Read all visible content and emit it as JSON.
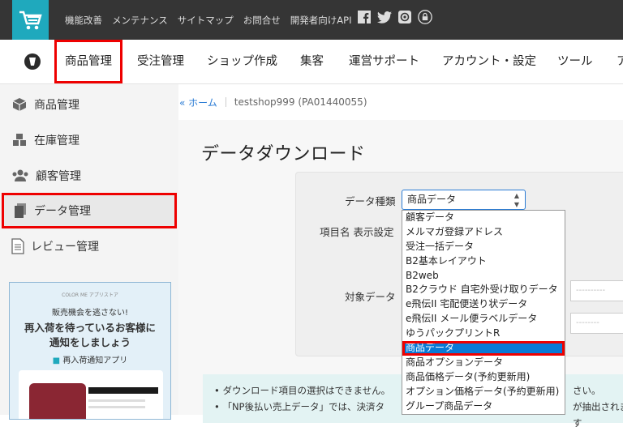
{
  "header": {
    "links": [
      "機能改善",
      "メンテナンス",
      "サイトマップ",
      "お問合せ",
      "開発者向けAPI"
    ],
    "icons": [
      "facebook-icon",
      "twitter-icon",
      "mail-icon",
      "lock-icon"
    ]
  },
  "nav": {
    "items": [
      "商品管理",
      "受注管理",
      "ショップ作成",
      "集客",
      "運営サポート",
      "アカウント・設定",
      "ツール",
      "ア"
    ]
  },
  "sidebar": {
    "items": [
      "商品管理",
      "在庫管理",
      "顧客管理",
      "データ管理",
      "レビュー管理"
    ],
    "promo": {
      "brand": "COLOR ME アプリストア",
      "line1": "販売機会を逃さない!",
      "line2a": "再入荷を待っているお客様に",
      "line2b": "通知をしましょう",
      "line3": "再入荷通知アプリ"
    }
  },
  "breadcrumb": {
    "home": "« ホーム",
    "shop": "testshop999 (PA01440055)"
  },
  "page": {
    "title": "データダウンロード"
  },
  "form": {
    "label_type": "データ種類",
    "label_item": "項目名 表示設定",
    "label_target": "対象データ",
    "selected": "商品データ",
    "input_placeholder1": "----------",
    "input_placeholder2": "--------",
    "options": [
      "顧客データ",
      "メルマガ登録アドレス",
      "受注一括データ",
      "B2基本レイアウト",
      "B2web",
      "B2クラウド 自宅外受け取りデータ",
      "e飛伝II 宅配便送り状データ",
      "e飛伝II メール便ラベルデータ",
      "ゆうパックプリントR",
      "商品データ",
      "商品オプションデータ",
      "商品価格データ(予約更新用)",
      "オプション価格データ(予約更新用)",
      "グループ商品データ"
    ],
    "selected_index": 9
  },
  "notes": {
    "line1": "ダウンロード項目の選択はできません。",
    "line1_end": "さい。",
    "line2": "「NP後払い売上データ」では、決済タ",
    "line2_end": "が抽出されます"
  },
  "colors": {
    "accent": "#1fa9bd",
    "highlight": "#e00000",
    "select_blue": "#0a7ad6"
  }
}
